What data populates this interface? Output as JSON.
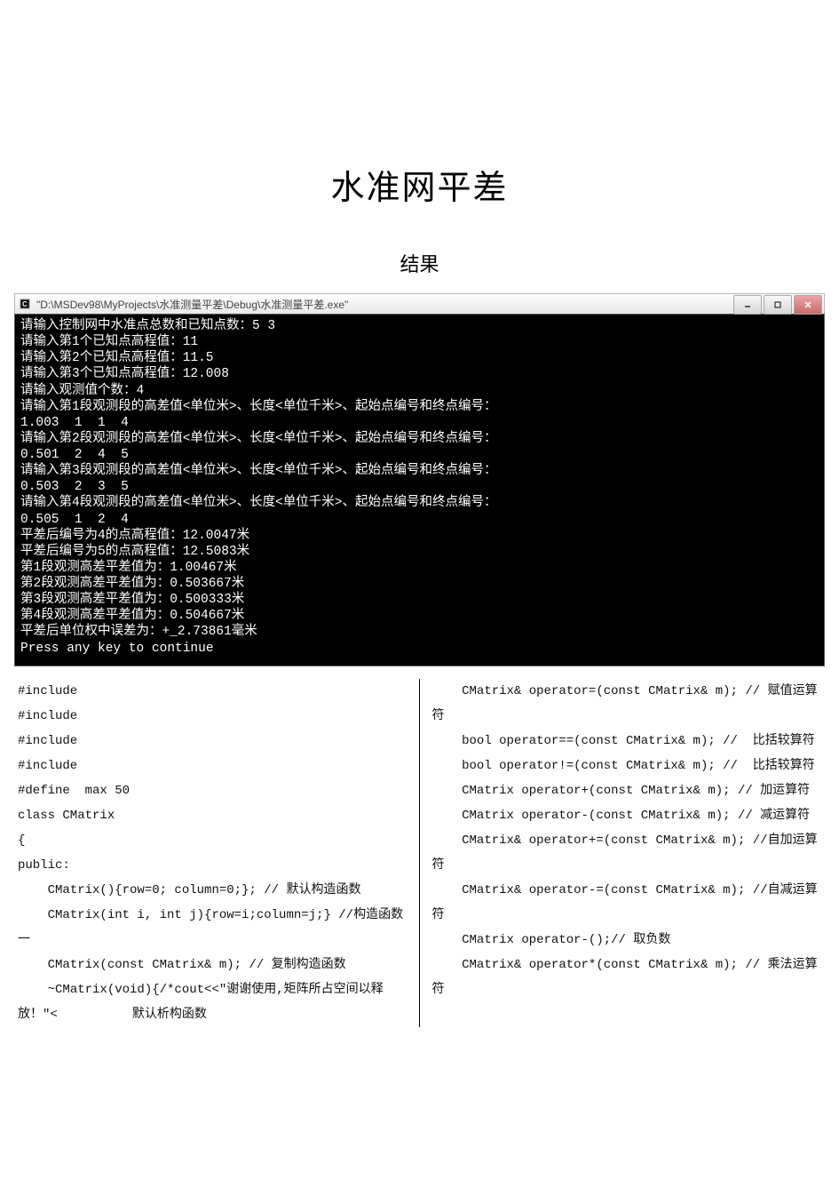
{
  "title": "水准网平差",
  "subtitle": "结果",
  "console": {
    "window_title": "\"D:\\MSDev98\\MyProjects\\水准测量平差\\Debug\\水准测量平差.exe\"",
    "lines": [
      "请输入控制网中水准点总数和已知点数：5 3",
      "请输入第1个已知点高程值：11",
      "请输入第2个已知点高程值：11.5",
      "请输入第3个已知点高程值：12.008",
      "请输入观测值个数：4",
      "请输入第1段观测段的高差值<单位米>、长度<单位千米>、起始点编号和终点编号：",
      "1.003  1  1  4",
      "请输入第2段观测段的高差值<单位米>、长度<单位千米>、起始点编号和终点编号：",
      "0.501  2  4  5",
      "请输入第3段观测段的高差值<单位米>、长度<单位千米>、起始点编号和终点编号：",
      "0.503  2  3  5",
      "请输入第4段观测段的高差值<单位米>、长度<单位千米>、起始点编号和终点编号：",
      "0.505  1  2  4",
      "平差后编号为4的点高程值：12.0047米",
      "平差后编号为5的点高程值：12.5083米",
      "第1段观测高差平差值为：1.00467米",
      "第2段观测高差平差值为：0.503667米",
      "第3段观测高差平差值为：0.500333米",
      "第4段观测高差平差值为：0.504667米",
      "平差后单位权中误差为：+_2.73861毫米",
      "Press any key to continue"
    ]
  },
  "code_left": [
    "#include",
    "#include",
    "#include",
    "#include",
    "#define  max 50",
    "",
    "class CMatrix",
    "{",
    "public:",
    "    CMatrix(){row=0; column=0;}; // 默认构造函数",
    "    CMatrix(int i, int j){row=i;column=j;} //构造函数一",
    "    CMatrix(const CMatrix& m); // 复制构造函数",
    "    ~CMatrix(void){/*cout<<\"谢谢使用,矩阵所占空间以释放！\"<          默认析构函数"
  ],
  "code_right": [
    "    CMatrix& operator=(const CMatrix& m); // 赋值运算符",
    "    bool operator==(const CMatrix& m); //  比括较算符",
    "    bool operator!=(const CMatrix& m); //  比括较算符",
    "    CMatrix operator+(const CMatrix& m); // 加运算符",
    "    CMatrix operator-(const CMatrix& m); // 减运算符",
    "    CMatrix& operator+=(const CMatrix& m); //自加运算符",
    "    CMatrix& operator-=(const CMatrix& m); //自减运算符",
    "    CMatrix operator-();// 取负数",
    "    CMatrix& operator*(const CMatrix& m); // 乘法运算符"
  ]
}
